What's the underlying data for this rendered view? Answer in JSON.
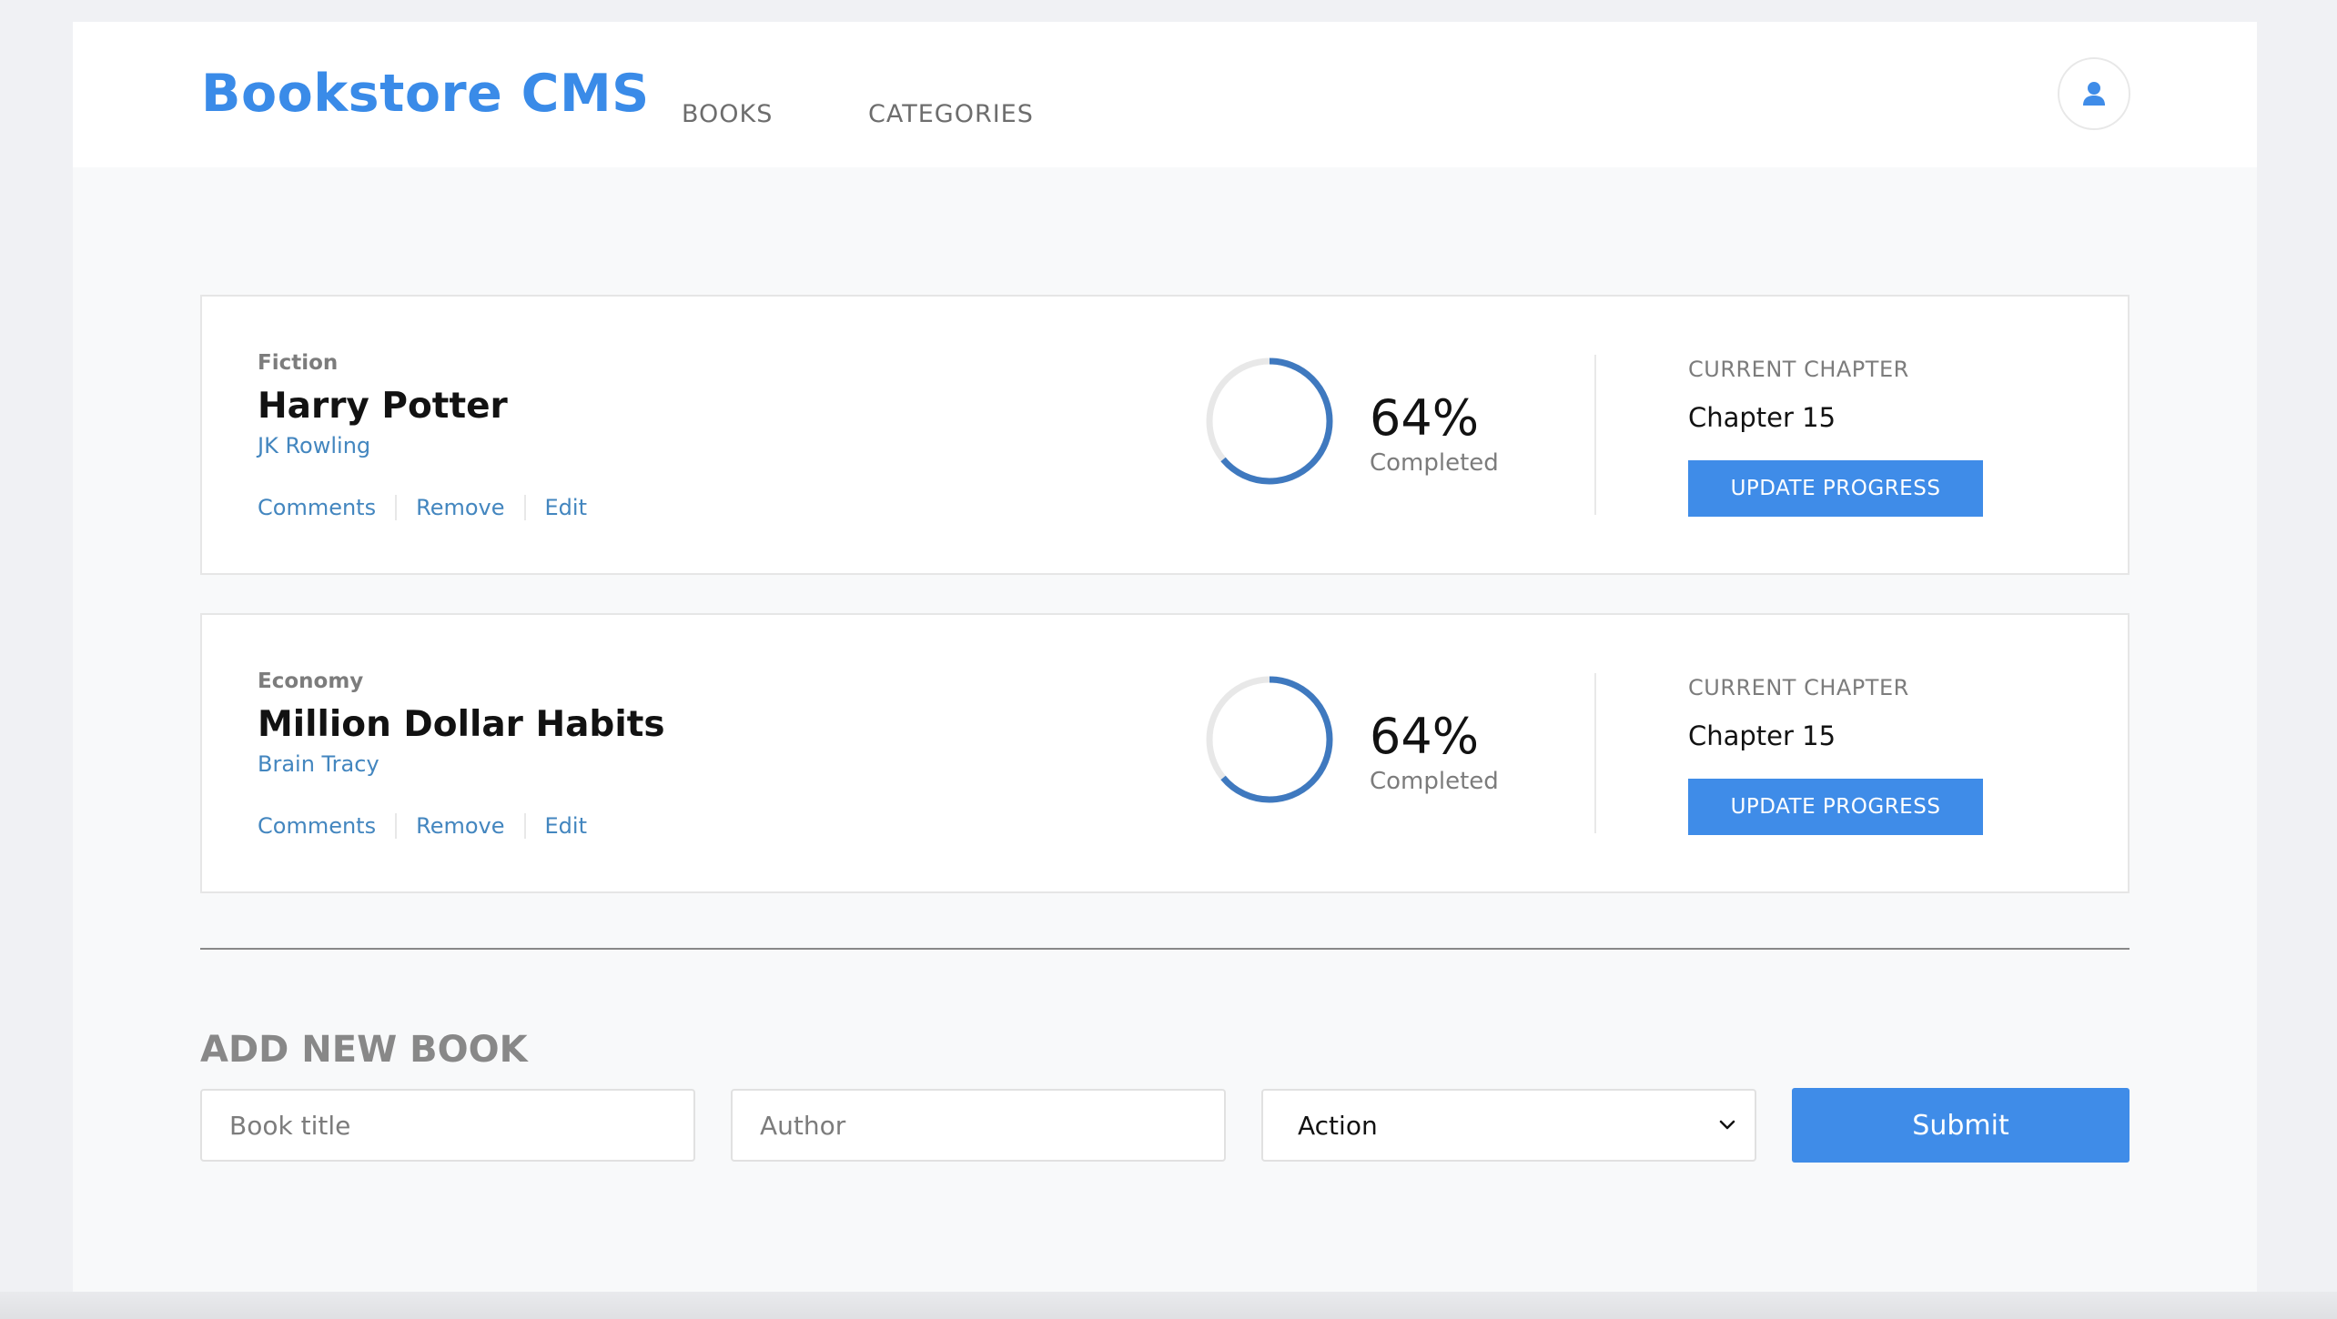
{
  "header": {
    "logo": "Bookstore CMS",
    "nav": [
      {
        "label": "BOOKS"
      },
      {
        "label": "CATEGORIES"
      }
    ],
    "user_icon": "user-icon"
  },
  "books": [
    {
      "category": "Fiction",
      "title": "Harry Potter",
      "author": "JK Rowling",
      "actions": [
        "Comments",
        "Remove",
        "Edit"
      ],
      "progress_percent": 64,
      "progress_label": "64%",
      "completed_label": "Completed",
      "current_chapter_label": "CURRENT CHAPTER",
      "current_chapter": "Chapter 15",
      "update_button": "UPDATE PROGRESS"
    },
    {
      "category": "Economy",
      "title": "Million Dollar Habits",
      "author": "Brain Tracy",
      "actions": [
        "Comments",
        "Remove",
        "Edit"
      ],
      "progress_percent": 64,
      "progress_label": "64%",
      "completed_label": "Completed",
      "current_chapter_label": "CURRENT CHAPTER",
      "current_chapter": "Chapter 15",
      "update_button": "UPDATE PROGRESS"
    }
  ],
  "form": {
    "title": "ADD NEW BOOK",
    "title_placeholder": "Book title",
    "author_placeholder": "Author",
    "select_value": "Action",
    "submit_label": "Submit"
  },
  "colors": {
    "accent": "#3f8ce8",
    "logo": "#3a8be8",
    "link": "#4386bf",
    "ring": "#3f79bf",
    "ring_track": "#e8e8e8"
  }
}
